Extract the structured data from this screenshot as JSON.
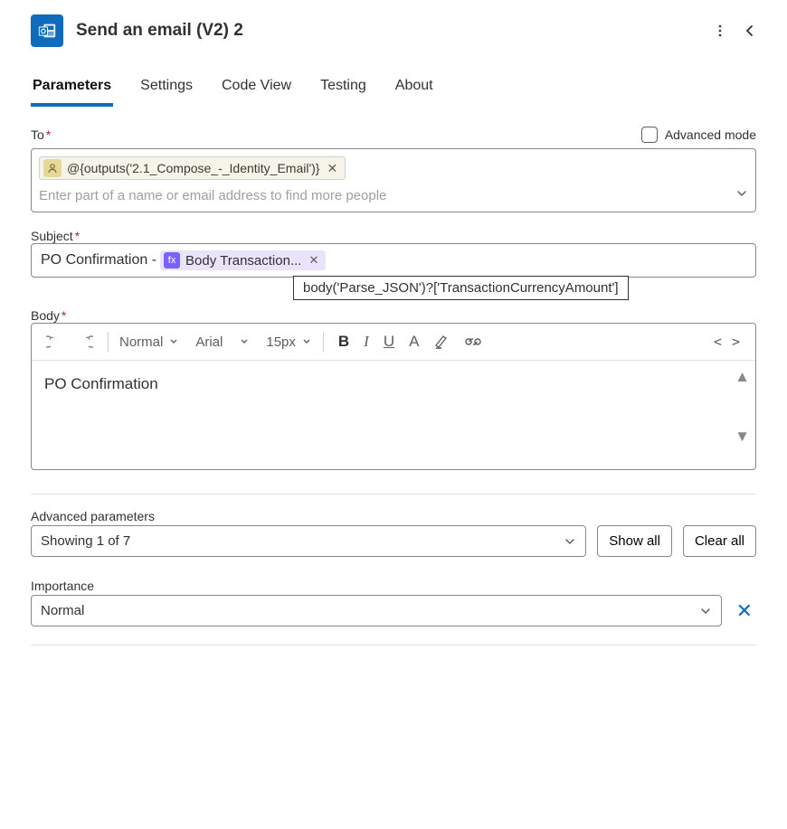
{
  "header": {
    "title": "Send an email (V2) 2"
  },
  "tabs": [
    "Parameters",
    "Settings",
    "Code View",
    "Testing",
    "About"
  ],
  "active_tab": "Parameters",
  "to": {
    "label": "To",
    "adv_mode_label": "Advanced mode",
    "chip_text": "@{outputs('2.1_Compose_-_Identity_Email')}",
    "placeholder": "Enter part of a name or email address to find more people"
  },
  "subject": {
    "label": "Subject",
    "prefix_text": "PO Confirmation - ",
    "token_label": "Body Transaction...",
    "tooltip": "body('Parse_JSON')?['TransactionCurrencyAmount']"
  },
  "body": {
    "label": "Body",
    "content": "PO Confirmation",
    "toolbar": {
      "style": "Normal",
      "font": "Arial",
      "size": "15px",
      "bold": "B",
      "italic": "I",
      "underline": "U",
      "fontA": "A",
      "code_toggle": "< >"
    }
  },
  "advanced": {
    "label": "Advanced parameters",
    "showing": "Showing 1 of 7",
    "show_all": "Show all",
    "clear_all": "Clear all"
  },
  "importance": {
    "label": "Importance",
    "value": "Normal"
  }
}
